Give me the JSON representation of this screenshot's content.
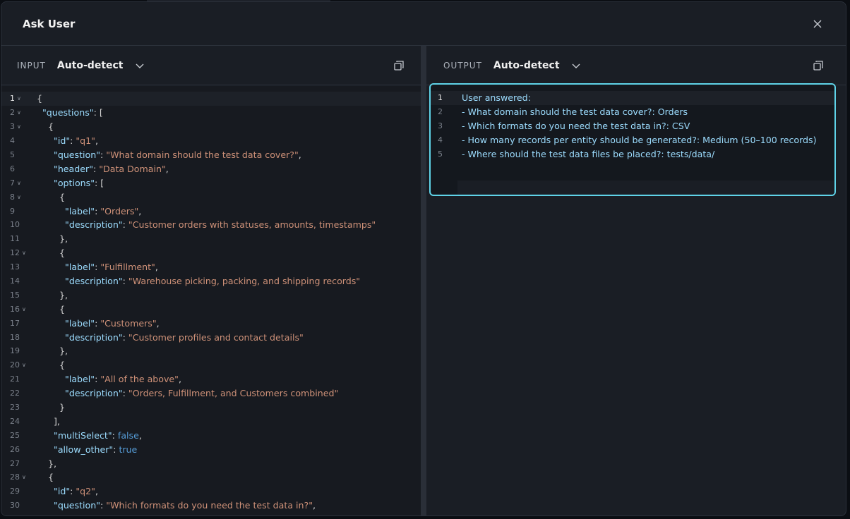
{
  "dialog": {
    "title": "Ask User",
    "close_glyph": "×"
  },
  "input_pane": {
    "label": "INPUT",
    "format": "Auto-detect",
    "copy_icon": "copy-icon",
    "lines": [
      {
        "n": "1",
        "fold": true,
        "active": true,
        "parts": [
          [
            "p",
            "{"
          ]
        ]
      },
      {
        "n": "2",
        "fold": true,
        "parts": [
          [
            "p",
            "  "
          ],
          [
            "k",
            "\"questions\""
          ],
          [
            "p",
            ": ["
          ]
        ]
      },
      {
        "n": "3",
        "fold": true,
        "parts": [
          [
            "p",
            "    {"
          ]
        ]
      },
      {
        "n": "4",
        "parts": [
          [
            "p",
            "      "
          ],
          [
            "k",
            "\"id\""
          ],
          [
            "p",
            ": "
          ],
          [
            "s",
            "\"q1\""
          ],
          [
            "p",
            ","
          ]
        ]
      },
      {
        "n": "5",
        "parts": [
          [
            "p",
            "      "
          ],
          [
            "k",
            "\"question\""
          ],
          [
            "p",
            ": "
          ],
          [
            "s",
            "\"What domain should the test data cover?\""
          ],
          [
            "p",
            ","
          ]
        ]
      },
      {
        "n": "6",
        "parts": [
          [
            "p",
            "      "
          ],
          [
            "k",
            "\"header\""
          ],
          [
            "p",
            ": "
          ],
          [
            "s",
            "\"Data Domain\""
          ],
          [
            "p",
            ","
          ]
        ]
      },
      {
        "n": "7",
        "fold": true,
        "parts": [
          [
            "p",
            "      "
          ],
          [
            "k",
            "\"options\""
          ],
          [
            "p",
            ": ["
          ]
        ]
      },
      {
        "n": "8",
        "fold": true,
        "parts": [
          [
            "p",
            "        {"
          ]
        ]
      },
      {
        "n": "9",
        "parts": [
          [
            "p",
            "          "
          ],
          [
            "k",
            "\"label\""
          ],
          [
            "p",
            ": "
          ],
          [
            "s",
            "\"Orders\""
          ],
          [
            "p",
            ","
          ]
        ]
      },
      {
        "n": "10",
        "parts": [
          [
            "p",
            "          "
          ],
          [
            "k",
            "\"description\""
          ],
          [
            "p",
            ": "
          ],
          [
            "s",
            "\"Customer orders with statuses, amounts, timestamps\""
          ]
        ]
      },
      {
        "n": "11",
        "parts": [
          [
            "p",
            "        },"
          ]
        ]
      },
      {
        "n": "12",
        "fold": true,
        "parts": [
          [
            "p",
            "        {"
          ]
        ]
      },
      {
        "n": "13",
        "parts": [
          [
            "p",
            "          "
          ],
          [
            "k",
            "\"label\""
          ],
          [
            "p",
            ": "
          ],
          [
            "s",
            "\"Fulfillment\""
          ],
          [
            "p",
            ","
          ]
        ]
      },
      {
        "n": "14",
        "parts": [
          [
            "p",
            "          "
          ],
          [
            "k",
            "\"description\""
          ],
          [
            "p",
            ": "
          ],
          [
            "s",
            "\"Warehouse picking, packing, and shipping records\""
          ]
        ]
      },
      {
        "n": "15",
        "parts": [
          [
            "p",
            "        },"
          ]
        ]
      },
      {
        "n": "16",
        "fold": true,
        "parts": [
          [
            "p",
            "        {"
          ]
        ]
      },
      {
        "n": "17",
        "parts": [
          [
            "p",
            "          "
          ],
          [
            "k",
            "\"label\""
          ],
          [
            "p",
            ": "
          ],
          [
            "s",
            "\"Customers\""
          ],
          [
            "p",
            ","
          ]
        ]
      },
      {
        "n": "18",
        "parts": [
          [
            "p",
            "          "
          ],
          [
            "k",
            "\"description\""
          ],
          [
            "p",
            ": "
          ],
          [
            "s",
            "\"Customer profiles and contact details\""
          ]
        ]
      },
      {
        "n": "19",
        "parts": [
          [
            "p",
            "        },"
          ]
        ]
      },
      {
        "n": "20",
        "fold": true,
        "parts": [
          [
            "p",
            "        {"
          ]
        ]
      },
      {
        "n": "21",
        "parts": [
          [
            "p",
            "          "
          ],
          [
            "k",
            "\"label\""
          ],
          [
            "p",
            ": "
          ],
          [
            "s",
            "\"All of the above\""
          ],
          [
            "p",
            ","
          ]
        ]
      },
      {
        "n": "22",
        "parts": [
          [
            "p",
            "          "
          ],
          [
            "k",
            "\"description\""
          ],
          [
            "p",
            ": "
          ],
          [
            "s",
            "\"Orders, Fulfillment, and Customers combined\""
          ]
        ]
      },
      {
        "n": "23",
        "parts": [
          [
            "p",
            "        }"
          ]
        ]
      },
      {
        "n": "24",
        "parts": [
          [
            "p",
            "      ],"
          ]
        ]
      },
      {
        "n": "25",
        "parts": [
          [
            "p",
            "      "
          ],
          [
            "k",
            "\"multiSelect\""
          ],
          [
            "p",
            ": "
          ],
          [
            "b",
            "false"
          ],
          [
            "p",
            ","
          ]
        ]
      },
      {
        "n": "26",
        "parts": [
          [
            "p",
            "      "
          ],
          [
            "k",
            "\"allow_other\""
          ],
          [
            "p",
            ": "
          ],
          [
            "b",
            "true"
          ]
        ]
      },
      {
        "n": "27",
        "parts": [
          [
            "p",
            "    },"
          ]
        ]
      },
      {
        "n": "28",
        "fold": true,
        "parts": [
          [
            "p",
            "    {"
          ]
        ]
      },
      {
        "n": "29",
        "parts": [
          [
            "p",
            "      "
          ],
          [
            "k",
            "\"id\""
          ],
          [
            "p",
            ": "
          ],
          [
            "s",
            "\"q2\""
          ],
          [
            "p",
            ","
          ]
        ]
      },
      {
        "n": "30",
        "parts": [
          [
            "p",
            "      "
          ],
          [
            "k",
            "\"question\""
          ],
          [
            "p",
            ": "
          ],
          [
            "s",
            "\"Which formats do you need the test data in?\""
          ],
          [
            "p",
            ","
          ]
        ]
      }
    ]
  },
  "output_pane": {
    "label": "OUTPUT",
    "format": "Auto-detect",
    "copy_icon": "copy-icon",
    "lines": [
      {
        "n": "1",
        "active": true,
        "text": "User answered:"
      },
      {
        "n": "2",
        "text": "- What domain should the test data cover?: Orders"
      },
      {
        "n": "3",
        "text": "- Which formats do you need the test data in?: CSV"
      },
      {
        "n": "4",
        "text": "- How many records per entity should be generated?: Medium (50–100 records)"
      },
      {
        "n": "5",
        "text": "- Where should the test data files be placed?: tests/data/"
      }
    ]
  }
}
